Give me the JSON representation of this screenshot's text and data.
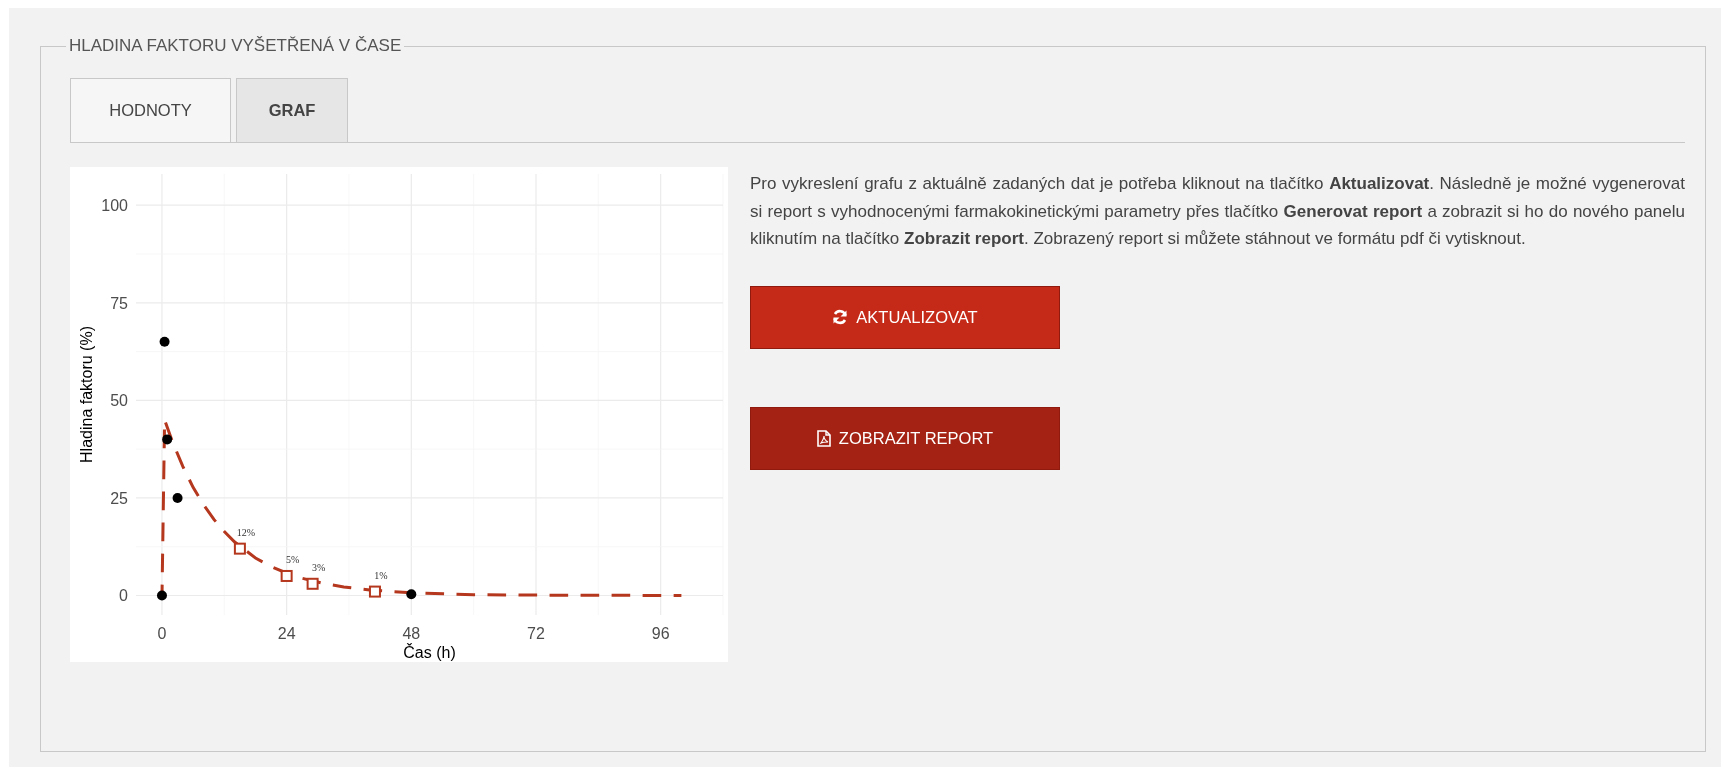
{
  "panel": {
    "legend": "HLADINA FAKTORU VYŠETŘENÁ V ČASE"
  },
  "tabs": [
    {
      "label": "HODNOTY",
      "selected": false
    },
    {
      "label": "GRAF",
      "selected": true
    }
  ],
  "chart_data": {
    "type": "line",
    "xlabel": "Čas (h)",
    "ylabel": "Hladina faktoru (%)",
    "xlim": [
      -5,
      108
    ],
    "ylim": [
      -5,
      108
    ],
    "xticks": [
      0,
      24,
      48,
      72,
      96
    ],
    "yticks": [
      0,
      25,
      50,
      75,
      100
    ],
    "series": [
      {
        "line_style": "dashed",
        "color": "#b5371d",
        "x": [
          0,
          0.5,
          2,
          4,
          6,
          8,
          10,
          12,
          14,
          18,
          21,
          25,
          27,
          31,
          35,
          40,
          48,
          60,
          72,
          100
        ],
        "values": [
          0,
          45,
          39.4,
          33.1,
          27.7,
          23.3,
          19.5,
          16.4,
          13.7,
          9.6,
          7.4,
          5.2,
          4.4,
          3.1,
          2.2,
          1.4,
          0.7,
          0.2,
          0.1,
          0
        ]
      },
      {
        "type": "scatter",
        "marker": "square",
        "color": "#b5371d",
        "x": [
          15,
          24,
          29,
          41
        ],
        "values": [
          12,
          5,
          3,
          1
        ]
      },
      {
        "type": "scatter",
        "marker": "circle",
        "color": "#000000",
        "x": [
          0,
          0.5,
          1,
          3,
          48
        ],
        "values": [
          0,
          65,
          40,
          25,
          0.3
        ]
      }
    ],
    "grid": true,
    "annotations": [
      {
        "x": 15,
        "y": 12,
        "text": "12%"
      },
      {
        "x": 24,
        "y": 5,
        "text": "5%"
      },
      {
        "x": 29,
        "y": 3,
        "text": "3%"
      },
      {
        "x": 41,
        "y": 1,
        "text": "1%"
      }
    ]
  },
  "info": {
    "text": "Pro vykreslení grafu z aktuálně zadaných dat je potřeba kliknout na tlačítko **Aktualizovat**. Následně je možné vygenerovat si report s vyhodnocenými farmakokinetickými parametry přes tlačítko **Generovat report** a zobrazit si ho do nového panelu kliknutím na tlačítko **Zobrazit report**. Zobrazený report si můžete stáhnout ve formátu pdf či vytisknout."
  },
  "buttons": [
    {
      "label": "AKTUALIZOVAT",
      "kind": "refresh"
    },
    {
      "label": "ZOBRAZIT REPORT",
      "kind": "pdf"
    }
  ]
}
